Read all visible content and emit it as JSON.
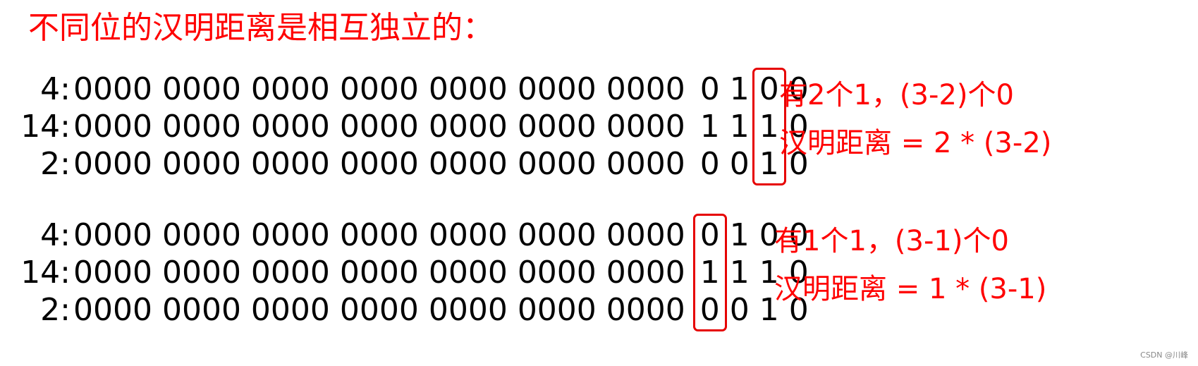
{
  "title": "不同位的汉明距离是相互独立的：",
  "groups": [
    {
      "rows": [
        {
          "label": "4:",
          "prefix": "0000 0000 0000 0000 0000 0000 0000",
          "bits": [
            "0",
            "1",
            "0",
            "0"
          ]
        },
        {
          "label": "14:",
          "prefix": "0000 0000 0000 0000 0000 0000 0000",
          "bits": [
            "1",
            "1",
            "1",
            "0"
          ]
        },
        {
          "label": "2:",
          "prefix": "0000 0000 0000 0000 0000 0000 0000",
          "bits": [
            "0",
            "0",
            "1",
            "0"
          ]
        }
      ],
      "highlight_bit_index": 2,
      "note_count": "有2个1，(3-2)个0",
      "note_distance": "汉明距离 = 2 * (3-2)"
    },
    {
      "rows": [
        {
          "label": "4:",
          "prefix": "0000 0000 0000 0000 0000 0000 0000",
          "bits": [
            "0",
            "1",
            "0",
            "0"
          ]
        },
        {
          "label": "14:",
          "prefix": "0000 0000 0000 0000 0000 0000 0000",
          "bits": [
            "1",
            "1",
            "1",
            "0"
          ]
        },
        {
          "label": "2:",
          "prefix": "0000 0000 0000 0000 0000 0000 0000",
          "bits": [
            "0",
            "0",
            "1",
            "0"
          ]
        }
      ],
      "highlight_bit_index": 0,
      "note_count": "有1个1，(3-1)个0",
      "note_distance": "汉明距离 = 1 * (3-1)"
    }
  ],
  "watermark": "CSDN @川峰",
  "colors": {
    "accent": "#ff0000",
    "box": "#e60000",
    "text": "#000000"
  }
}
